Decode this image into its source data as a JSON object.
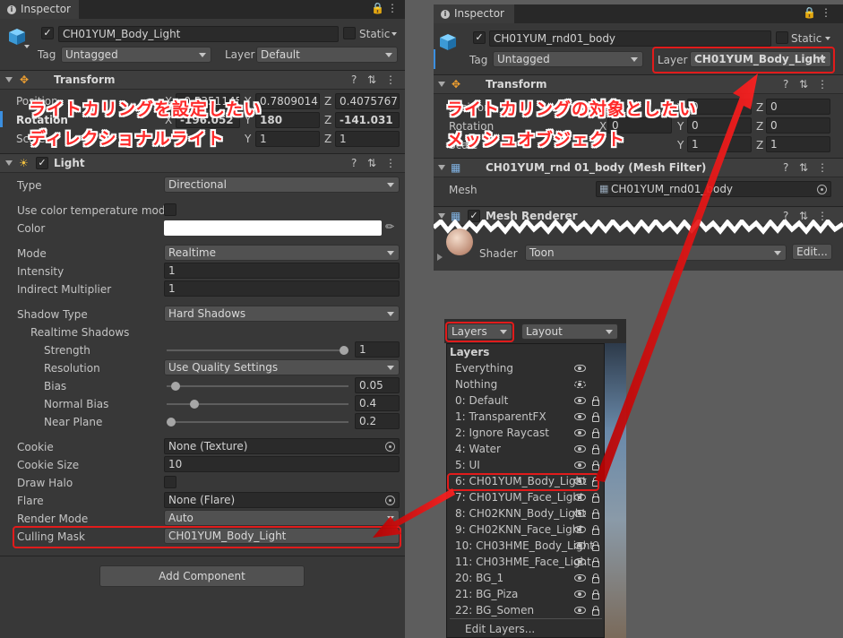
{
  "left_panel": {
    "tab_title": "Inspector",
    "object_name": "CH01YUM_Body_Light",
    "static_label": "Static",
    "tag_label": "Tag",
    "tag_value": "Untagged",
    "layer_label": "Layer",
    "layer_value": "Default",
    "transform": {
      "title": "Transform",
      "position_label": "Position",
      "rotation_label": "Rotation",
      "scale_label": "Scale",
      "pos_x": "-0.5351145",
      "pos_y": "0.7809014",
      "pos_z": "0.4075767",
      "rot_x": "-196.052",
      "rot_y": "180",
      "rot_z": "-141.031",
      "scale_y": "1",
      "scale_z": "1",
      "x": "X",
      "y": "Y",
      "z": "Z"
    },
    "light": {
      "title": "Light",
      "type_label": "Type",
      "type_value": "Directional",
      "color_temp_label": "Use color temperature mode",
      "color_label": "Color",
      "color_value": "#ffffff",
      "mode_label": "Mode",
      "mode_value": "Realtime",
      "intensity_label": "Intensity",
      "intensity_value": "1",
      "indirect_label": "Indirect Multiplier",
      "indirect_value": "1",
      "shadow_type_label": "Shadow Type",
      "shadow_type_value": "Hard Shadows",
      "realtime_shadows_label": "Realtime Shadows",
      "strength_label": "Strength",
      "strength_value": "1",
      "strength_fraction": 1.0,
      "resolution_label": "Resolution",
      "resolution_value": "Use Quality Settings",
      "bias_label": "Bias",
      "bias_value": "0.05",
      "bias_fraction": 0.025,
      "normal_bias_label": "Normal Bias",
      "normal_bias_value": "0.4",
      "normal_bias_fraction": 0.133,
      "near_plane_label": "Near Plane",
      "near_plane_value": "0.2",
      "near_plane_fraction": 0.0,
      "cookie_label": "Cookie",
      "cookie_value": "None (Texture)",
      "cookie_size_label": "Cookie Size",
      "cookie_size_value": "10",
      "draw_halo_label": "Draw Halo",
      "flare_label": "Flare",
      "flare_value": "None (Flare)",
      "render_mode_label": "Render Mode",
      "render_mode_value": "Auto",
      "culling_mask_label": "Culling Mask",
      "culling_mask_value": "CH01YUM_Body_Light"
    },
    "add_component": "Add Component",
    "annotation_line1": "ライトカリングを設定したい",
    "annotation_line2": "ディレクショナルライト"
  },
  "right_panel": {
    "tab_title": "Inspector",
    "object_name": "CH01YUM_rnd01_body",
    "static_label": "Static",
    "tag_label": "Tag",
    "tag_value": "Untagged",
    "layer_label": "Layer",
    "layer_value": "CH01YUM_Body_Light",
    "transform_title": "Transform",
    "position_label": "Position",
    "rotation_label": "Rotation",
    "scale_label": "Scale",
    "pos_y": "0",
    "pos_z": "0",
    "rot_x": "0",
    "rot_y": "0",
    "rot_z": "0",
    "scale_y": "1",
    "scale_z": "1",
    "mesh_filter_title": "CH01YUM_rnd 01_body (Mesh Filter)",
    "mesh_label": "Mesh",
    "mesh_value": "CH01YUM_rnd01_body",
    "mesh_renderer_title": "Mesh Renderer",
    "shader_label": "Shader",
    "shader_value": "Toon",
    "edit_label": "Edit...",
    "annotation_line1": "ライトカリングの対象としたい",
    "annotation_line2": "メッシュオブジェクト"
  },
  "layers_menu": {
    "layers_button": "Layers",
    "layout_button": "Layout",
    "header": "Layers",
    "items": [
      {
        "label": "Everything",
        "lock": false,
        "hidden": false
      },
      {
        "label": "Nothing",
        "lock": false,
        "hidden": true
      },
      {
        "label": "0: Default",
        "lock": true,
        "hidden": false
      },
      {
        "label": "1: TransparentFX",
        "lock": true,
        "hidden": false
      },
      {
        "label": "2: Ignore Raycast",
        "lock": true,
        "hidden": false
      },
      {
        "label": "4: Water",
        "lock": true,
        "hidden": false
      },
      {
        "label": "5: UI",
        "lock": true,
        "hidden": false
      },
      {
        "label": "6: CH01YUM_Body_Light",
        "lock": true,
        "hidden": false
      },
      {
        "label": "7: CH01YUM_Face_Light",
        "lock": true,
        "hidden": false
      },
      {
        "label": "8: CH02KNN_Body_Light",
        "lock": true,
        "hidden": false
      },
      {
        "label": "9: CH02KNN_Face_Light",
        "lock": true,
        "hidden": false
      },
      {
        "label": "10: CH03HME_Body_Light",
        "lock": true,
        "hidden": false
      },
      {
        "label": "11: CH03HME_Face_Light",
        "lock": true,
        "hidden": false
      },
      {
        "label": "20: BG_1",
        "lock": true,
        "hidden": false
      },
      {
        "label": "21: BG_Piza",
        "lock": true,
        "hidden": false
      },
      {
        "label": "22: BG_Somen",
        "lock": true,
        "hidden": false
      }
    ],
    "edit_layers": "Edit Layers..."
  },
  "colors": {
    "highlight": "#e11b1b",
    "panel_bg": "#383838",
    "header_bg": "#3e3e3e"
  }
}
